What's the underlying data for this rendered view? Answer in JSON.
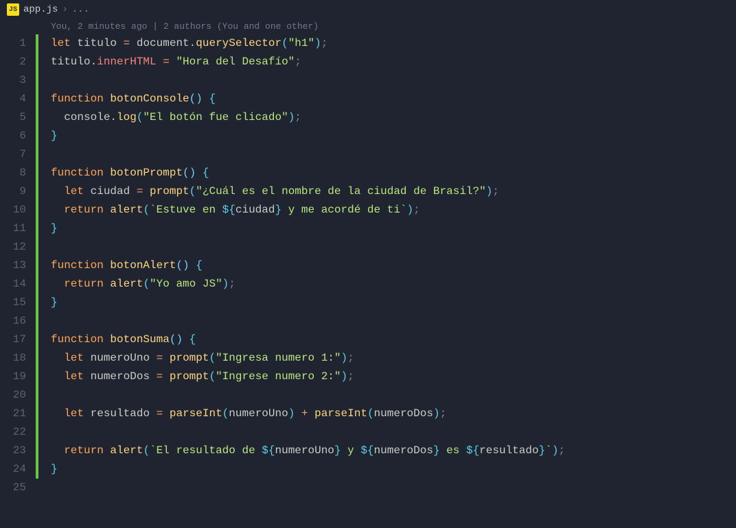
{
  "breadcrumb": {
    "icon_label": "JS",
    "filename": "app.js",
    "separator": "›",
    "tail": "...",
    "file_full": "app.js"
  },
  "codelens": {
    "text": "You, 2 minutes ago | 2 authors (You and one other)"
  },
  "lines": {
    "n1": "1",
    "n2": "2",
    "n3": "3",
    "n4": "4",
    "n5": "5",
    "n6": "6",
    "n7": "7",
    "n8": "8",
    "n9": "9",
    "n10": "10",
    "n11": "11",
    "n12": "12",
    "n13": "13",
    "n14": "14",
    "n15": "15",
    "n16": "16",
    "n17": "17",
    "n18": "18",
    "n19": "19",
    "n20": "20",
    "n21": "21",
    "n22": "22",
    "n23": "23",
    "n24": "24",
    "n25": "25"
  },
  "tok": {
    "let": "let",
    "function": "function",
    "return": "return",
    "titulo": "titulo",
    "document": "document",
    "querySelector": "querySelector",
    "h1": "\"h1\"",
    "innerHTML": "innerHTML",
    "hora": "\"Hora del Desafío\"",
    "botonConsole": "botonConsole",
    "console": "console",
    "log": "log",
    "strClicado": "\"El botón fue clicado\"",
    "botonPrompt": "botonPrompt",
    "ciudad": "ciudad",
    "prompt": "prompt",
    "strCual": "\"¿Cuál es el nombre de la ciudad de Brasil?\"",
    "alert": "alert",
    "tpl_estuve_a": "`Estuve en ",
    "tpl_estuve_b": " y me acordé de ti`",
    "botonAlert": "botonAlert",
    "strAmo": "\"Yo amo JS\"",
    "botonSuma": "botonSuma",
    "numeroUno": "numeroUno",
    "numeroDos": "numeroDos",
    "strNum1": "\"Ingresa numero 1:\"",
    "strNum2": "\"Ingrese numero 2:\"",
    "resultado": "resultado",
    "parseInt": "parseInt",
    "tpl_res_a": "`El resultado de ",
    "tpl_res_b": " y ",
    "tpl_res_c": " es ",
    "tpl_res_d": "`",
    "eq": " = ",
    "dot": ".",
    "semi": ";",
    "lp": "(",
    "rp": ")",
    "lb": "{",
    "rb": "}",
    "plus": " + ",
    "ds": "${",
    "de": "}",
    "empty_paren": "()"
  }
}
